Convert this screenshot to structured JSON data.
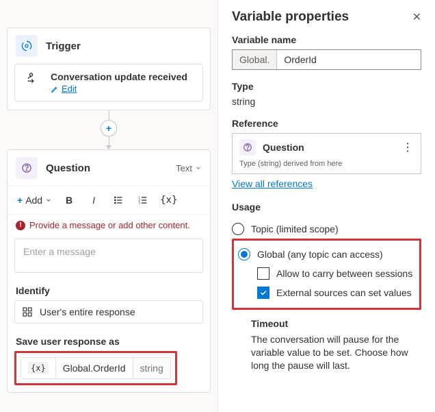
{
  "trigger": {
    "title": "Trigger",
    "event": "Conversation update received",
    "edit": "Edit"
  },
  "question": {
    "title": "Question",
    "outputType": "Text",
    "toolbar": {
      "add": "Add"
    },
    "error": "Provide a message or add other content.",
    "placeholder": "Enter a message",
    "identifyLabel": "Identify",
    "identifyValue": "User's entire response",
    "saveLabel": "Save user response as",
    "variableIcon": "{x}",
    "variableName": "Global.OrderId",
    "variableType": "string"
  },
  "panel": {
    "title": "Variable properties",
    "nameLabel": "Variable name",
    "prefix": "Global.",
    "name": "OrderId",
    "typeLabel": "Type",
    "typeValue": "string",
    "referenceLabel": "Reference",
    "referenceNode": "Question",
    "referenceSub": "Type (string) derived from here",
    "viewAll": "View all references",
    "usageLabel": "Usage",
    "usage": {
      "topic": "Topic (limited scope)",
      "global": "Global (any topic can access)",
      "carry": "Allow to carry between sessions",
      "external": "External sources can set values"
    },
    "timeoutLabel": "Timeout",
    "timeoutText": "The conversation will pause for the variable value to be set. Choose how long the pause will last."
  }
}
